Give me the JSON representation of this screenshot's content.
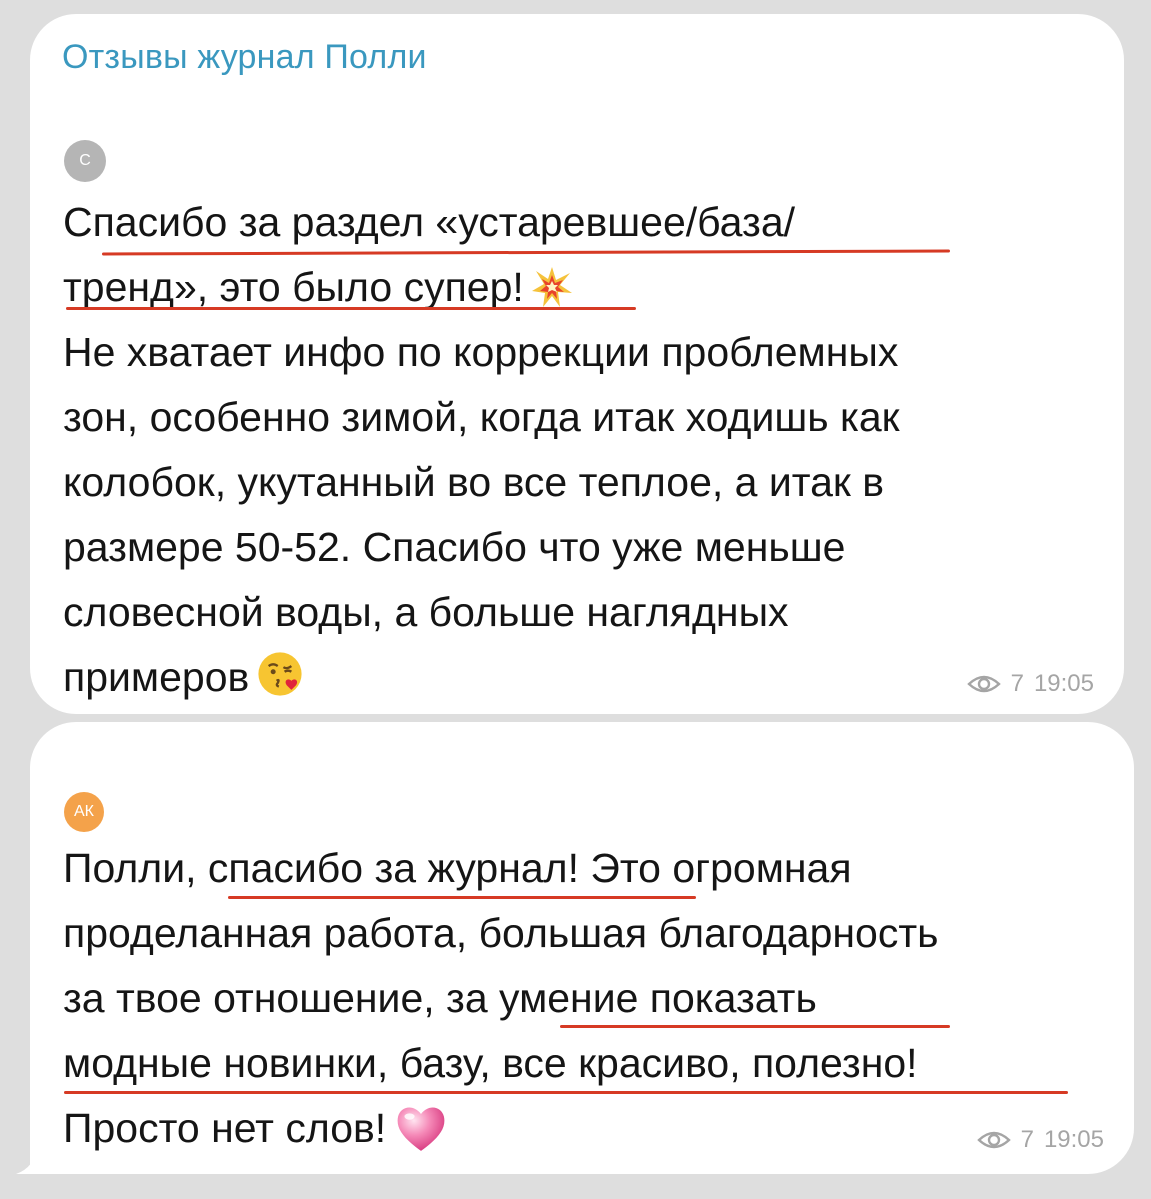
{
  "channel": {
    "title": "Отзывы журнал Полли"
  },
  "messages": [
    {
      "avatar_initials": "С",
      "avatar_color": "#b5b5b5",
      "lines": [
        "Спасибо за раздел «устаревшее/база/",
        "тренд», это было супер!",
        "Не хватает инфо по коррекции проблемных",
        "зон, особенно зимой, когда итак ходишь как",
        "колобок, укутанный во все теплое, а итак в",
        "размере 50-52. Спасибо что уже меньше",
        "словесной воды, а больше наглядных",
        "примеров"
      ],
      "emojis": [
        "collision-emoji",
        "kissing-heart-emoji"
      ],
      "views": "7",
      "time": "19:05"
    },
    {
      "avatar_initials": "АК",
      "avatar_color": "#f4a24a",
      "lines": [
        "Полли, спасибо за журнал! Это огромная",
        "проделанная работа, большая благодарность",
        "за твое отношение, за умение показать",
        "модные новинки, базу, все красиво, полезно!",
        "Просто нет слов!"
      ],
      "emojis": [
        "pink-heart-emoji"
      ],
      "views": "7",
      "time": "19:05"
    }
  ],
  "colors": {
    "background": "#dedede",
    "bubble": "#ffffff",
    "channel_title": "#3a98bf",
    "underline": "#d63a24",
    "meta": "#a5a5a5"
  }
}
